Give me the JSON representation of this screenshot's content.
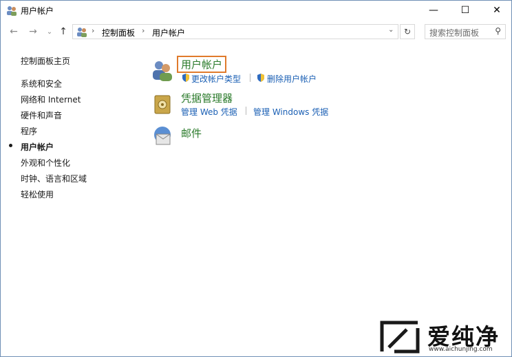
{
  "window": {
    "title": "用户帐户",
    "min_glyph": "—",
    "max_glyph": "☐",
    "close_glyph": "✕"
  },
  "nav": {
    "back_glyph": "←",
    "forward_glyph": "→",
    "recent_glyph": "⌄",
    "up_glyph": "↑",
    "breadcrumb": [
      "控制面板",
      "用户帐户"
    ],
    "sep_glyph": "›",
    "addr_dropdown_glyph": "⌄",
    "refresh_glyph": "↻",
    "search_placeholder": "搜索控制面板",
    "search_glyph": "⚲"
  },
  "sidebar": {
    "items": [
      {
        "label": "控制面板主页"
      },
      {
        "label": "系统和安全"
      },
      {
        "label": "网络和 Internet"
      },
      {
        "label": "硬件和声音"
      },
      {
        "label": "程序"
      },
      {
        "label": "用户帐户",
        "current": true
      },
      {
        "label": "外观和个性化"
      },
      {
        "label": "时钟、语言和区域"
      },
      {
        "label": "轻松使用"
      }
    ]
  },
  "categories": [
    {
      "title": "用户帐户",
      "icon": "users-icon",
      "links": [
        "更改帐户类型",
        "删除用户帐户"
      ]
    },
    {
      "title": "凭据管理器",
      "icon": "credential-vault-icon",
      "links": [
        "管理 Web 凭据",
        "管理 Windows 凭据"
      ]
    },
    {
      "title": "邮件",
      "icon": "mail-icon",
      "links": []
    }
  ],
  "watermark": {
    "title": "爱纯净",
    "url": "www.aichunjing.com"
  },
  "colors": {
    "link": "#1a5fb4",
    "category_title": "#2a7a2a",
    "highlight_border": "#e07a2b"
  }
}
